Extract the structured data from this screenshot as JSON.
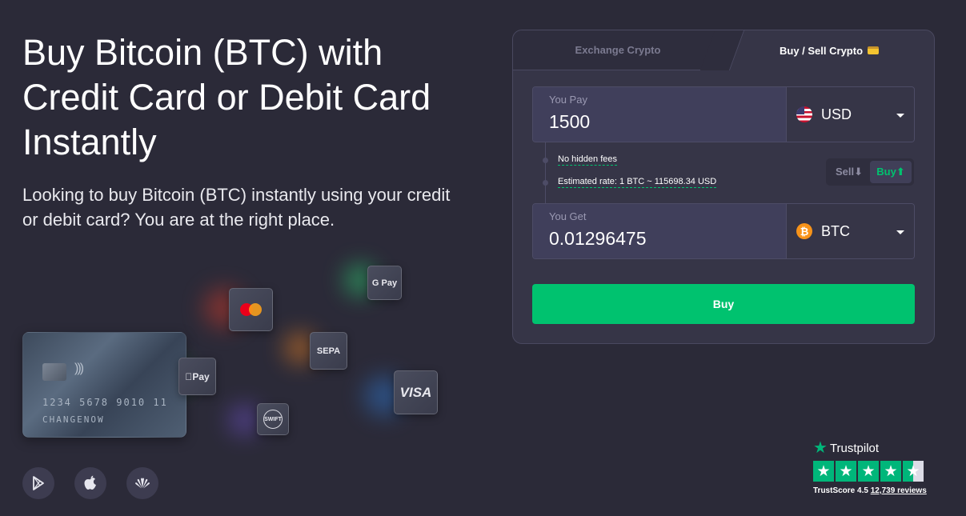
{
  "hero": {
    "title": "Buy Bitcoin (BTC) with Credit Card or Debit Card Instantly",
    "subtitle": "Looking to buy Bitcoin (BTC) instantly using your credit or debit card? You are at the right place."
  },
  "illustration": {
    "card_number": "1234 5678 9010 11",
    "card_name": "CHANGENOW",
    "badges": {
      "mastercard": "mastercard-icon",
      "google_pay": "G Pay",
      "sepa": "SEPA",
      "apple_pay": "Pay",
      "visa": "VISA",
      "swift": "SWIFT"
    }
  },
  "store_icons": [
    "google-play-icon",
    "apple-icon",
    "huawei-icon"
  ],
  "widget": {
    "tabs": {
      "exchange": "Exchange Crypto",
      "buy_sell": "Buy / Sell Crypto"
    },
    "pay": {
      "label": "You Pay",
      "value": "1500",
      "currency": "USD"
    },
    "get": {
      "label": "You Get",
      "value": "0.01296475",
      "currency": "BTC"
    },
    "info": {
      "fees": "No hidden fees",
      "rate": "Estimated rate: 1 BTC ~ 115698.34 USD"
    },
    "switch": {
      "sell": "Sell⬇",
      "buy": "Buy⬆",
      "active": "buy"
    },
    "buy_button": "Buy"
  },
  "trustpilot": {
    "brand": "Trustpilot",
    "score_label": "TrustScore 4.5",
    "reviews": "12,739 reviews",
    "stars": 4.5
  },
  "colors": {
    "background": "#2b2a38",
    "accent": "#00c26f",
    "panel": "#363547",
    "trustpilot_green": "#00b67a"
  }
}
